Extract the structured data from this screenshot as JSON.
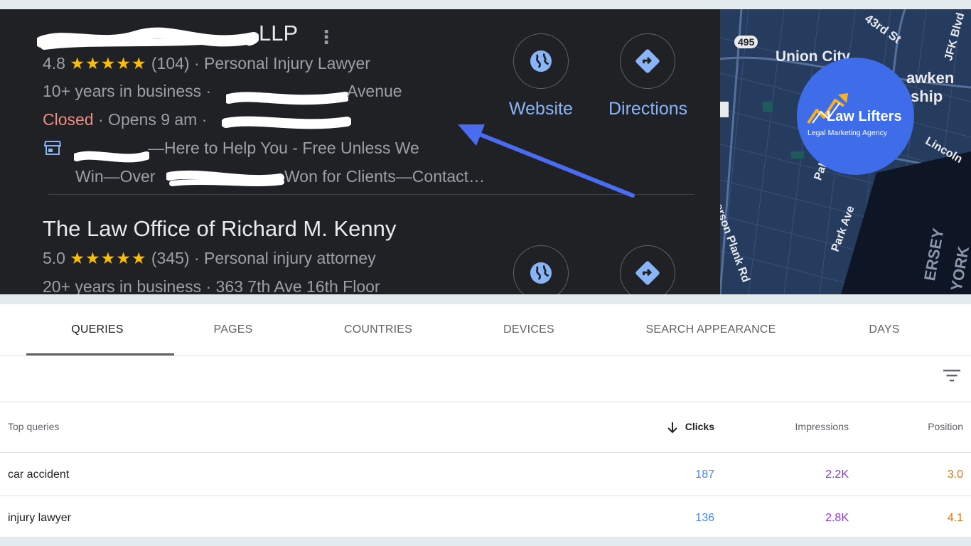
{
  "listing": {
    "first": {
      "title_suffix": "LLP",
      "rating": "4.8",
      "stars": "★★★★★",
      "reviews": "(104)",
      "category": "· Personal Injury Lawyer",
      "years": "10+ years in business ·",
      "address_suffix": "Avenue",
      "closed": "Closed",
      "opens": "· Opens 9 am ·",
      "ad_line1": "—Here to Help You - Free Unless We",
      "ad_line2_a": "Win—Over",
      "ad_line2_b": "Won for Clients—Contact…"
    },
    "second": {
      "title": "The Law Office of Richard M. Kenny",
      "rating": "5.0",
      "stars": "★★★★★",
      "reviews": "(345)",
      "category": "· Personal injury attorney",
      "years": "20+ years in business · 363 7th Ave 16th Floor"
    },
    "website_label": "Website",
    "directions_label": "Directions"
  },
  "map": {
    "labels": [
      "Union City",
      "43rd St",
      "JFK Blvd",
      "awken",
      "ship",
      "Lincoln",
      "Pal",
      "Park Ave",
      "erson Plank Rd",
      "ERSEY",
      "YORK"
    ],
    "route": "495"
  },
  "logo": {
    "name": "Law Lifters",
    "tagline": "Legal Marketing Agency"
  },
  "console": {
    "tabs": [
      "QUERIES",
      "PAGES",
      "COUNTRIES",
      "DEVICES",
      "SEARCH APPEARANCE",
      "DAYS"
    ],
    "active_tab": "QUERIES",
    "columns": {
      "query": "Top queries",
      "clicks": "Clicks",
      "impressions": "Impressions",
      "position": "Position"
    },
    "rows": [
      {
        "query": "car accident",
        "clicks": "187",
        "impressions": "2.2K",
        "position": "3.0"
      },
      {
        "query": "injury lawyer",
        "clicks": "136",
        "impressions": "2.8K",
        "position": "4.1"
      }
    ],
    "colors": {
      "clicks": "#4285f4",
      "impressions": "#9334e6",
      "position": "#e8710a"
    }
  }
}
